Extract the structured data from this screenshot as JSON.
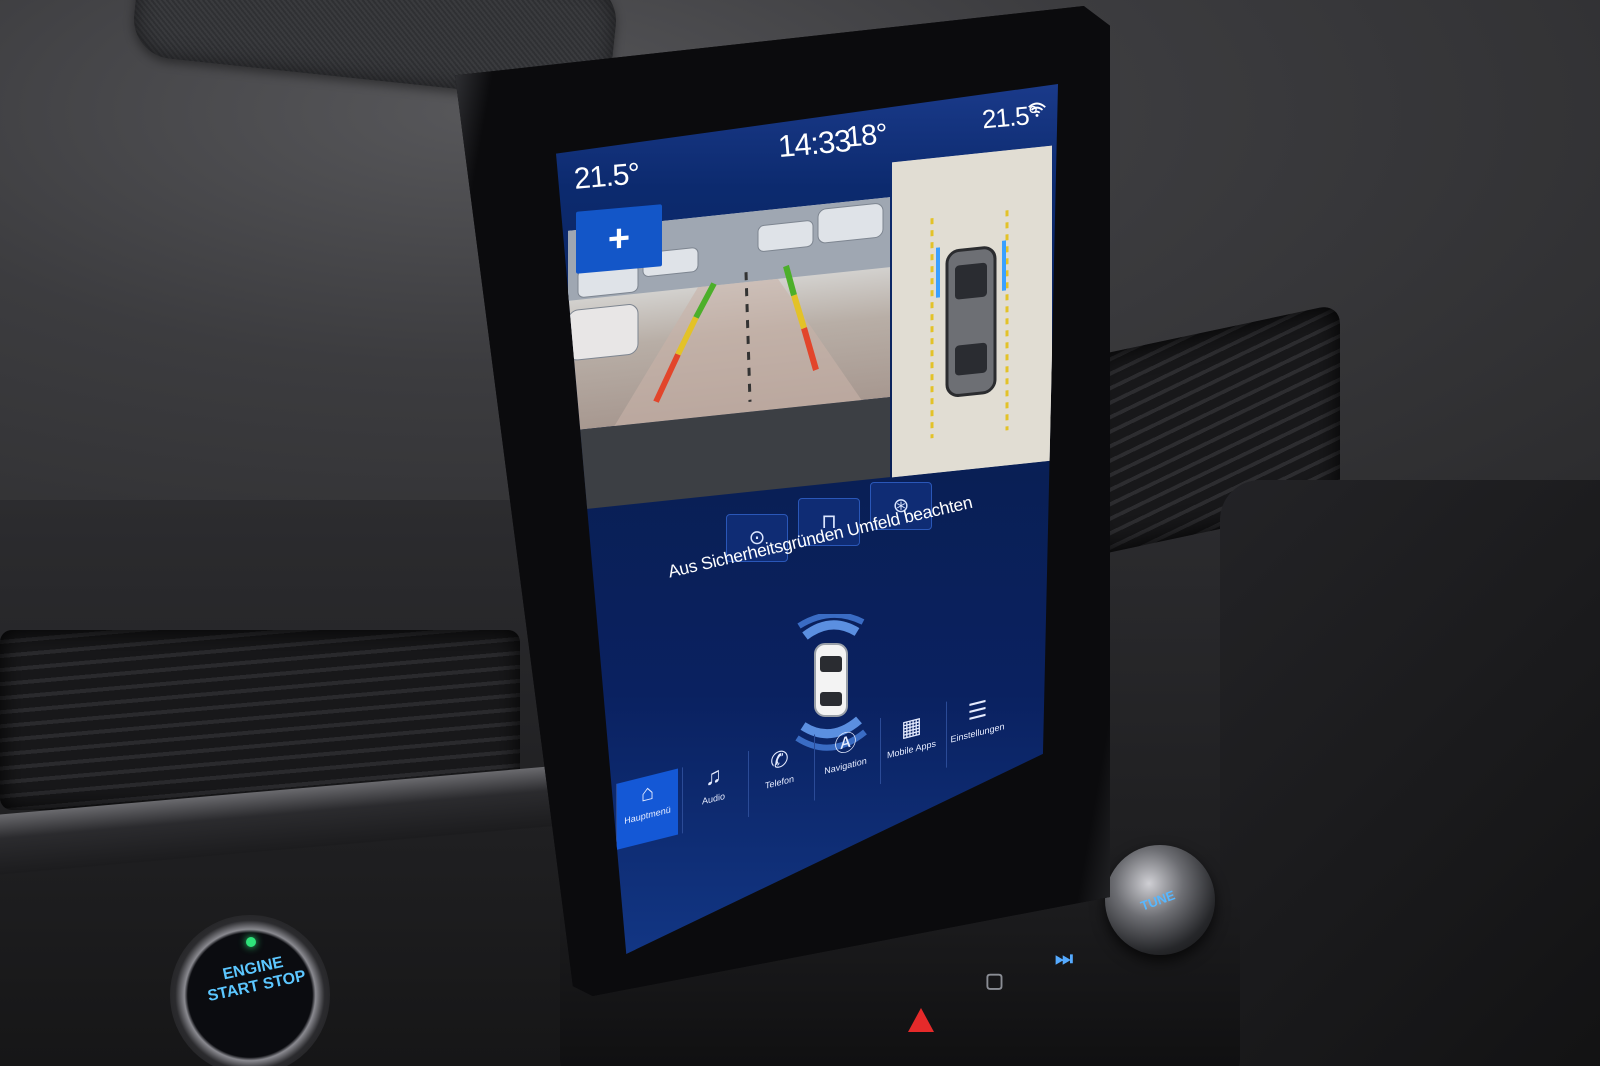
{
  "status_bar": {
    "left_temperature": "21.5°",
    "time": "14:33",
    "outside_temperature": "18°",
    "right_temperature": "21.5°"
  },
  "camera": {
    "zoom_button_label": "+",
    "views": [
      "rear-camera-view",
      "top-down-360-view"
    ]
  },
  "view_modes": [
    {
      "icon": "sensor-car-front-icon",
      "glyph": "⊙"
    },
    {
      "icon": "car-rear-icon",
      "glyph": "⊓"
    },
    {
      "icon": "car-sensor-top-icon",
      "glyph": "⊛"
    }
  ],
  "warning": {
    "text": "Aus Sicherheitsgründen Umfeld beachten"
  },
  "nav": {
    "items": [
      {
        "label": "Hauptmenü",
        "icon": "home-icon",
        "glyph": "⌂",
        "active": true
      },
      {
        "label": "Audio",
        "icon": "music-note-icon",
        "glyph": "♫",
        "active": false
      },
      {
        "label": "Telefon",
        "icon": "phone-icon",
        "glyph": "✆",
        "active": false
      },
      {
        "label": "Navigation",
        "icon": "navigation-icon",
        "glyph": "Ⓐ",
        "active": false
      },
      {
        "label": "Mobile Apps",
        "icon": "apps-grid-icon",
        "glyph": "▦",
        "active": false
      },
      {
        "label": "Einstellungen",
        "icon": "settings-icon",
        "glyph": "☰",
        "active": false
      }
    ]
  },
  "car_controls": {
    "start_button": "ENGINE START STOP",
    "knob_label": "TUNE"
  },
  "colors": {
    "accent": "#1458d6",
    "screen_bg": "#0a2160",
    "guide_green": "#4caf2a",
    "guide_yellow": "#e3c228",
    "guide_red": "#e2452b"
  }
}
